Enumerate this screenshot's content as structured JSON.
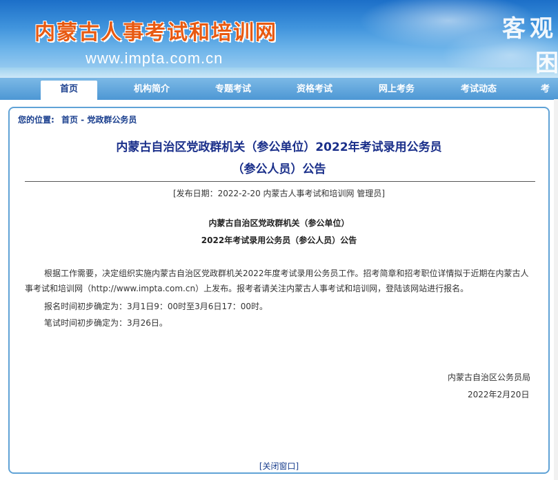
{
  "header": {
    "site_title": "内蒙古人事考试和培训网",
    "site_url": "www.impta.com.cn",
    "slogan_line1": "客观",
    "slogan_line2": "困"
  },
  "nav": {
    "items": [
      {
        "label": "首页"
      },
      {
        "label": "机构简介"
      },
      {
        "label": "专题考试"
      },
      {
        "label": "资格考试"
      },
      {
        "label": "网上考务"
      },
      {
        "label": "考试动态"
      },
      {
        "label": "考生"
      }
    ]
  },
  "breadcrumb": {
    "prefix": "您的位置:",
    "path": "首页 - 党政群公务员"
  },
  "article": {
    "title_line1": "内蒙古自治区党政群机关（参公单位）2022年考试录用公务员",
    "title_line2": "（参公人员）公告",
    "meta": "[发布日期：2022-2-20 内蒙古人事考试和培训网 管理员]",
    "sub_title1": "内蒙古自治区党政群机关（参公单位）",
    "sub_title2": "2022年考试录用公务员（参公人员）公告",
    "paragraph1": "根据工作需要，决定组织实施内蒙古自治区党政群机关2022年度考试录用公务员工作。招考简章和招考职位详情拟于近期在内蒙古人事考试和培训网（http://www.impta.com.cn）上发布。报考者请关注内蒙古人事考试和培训网，登陆该网站进行报名。",
    "paragraph2": "报名时间初步确定为：3月1日9：00时至3月6日17：00时。",
    "paragraph3": "笔试时间初步确定为：3月26日。",
    "signature_org": "内蒙古自治区公务员局",
    "signature_date": "2022年2月20日",
    "close_link": "[关闭窗口]"
  }
}
